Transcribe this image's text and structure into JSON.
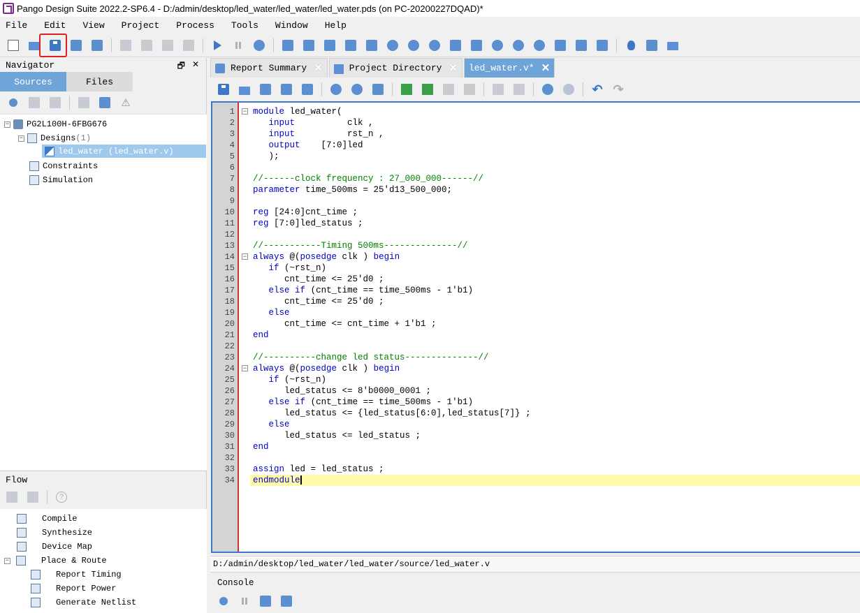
{
  "window": {
    "title": "Pango Design Suite 2022.2-SP6.4 - D:/admin/desktop/led_water/led_water/led_water.pds (on PC-20200227DQAD)*"
  },
  "menu": [
    "File",
    "Edit",
    "View",
    "Project",
    "Process",
    "Tools",
    "Window",
    "Help"
  ],
  "navigator": {
    "title": "Navigator",
    "tabs": [
      "Sources",
      "Files"
    ],
    "active_tab": "Sources",
    "tree": {
      "device": "PG2L100H-6FBG676",
      "designs_label": "Designs",
      "designs_count": "(1)",
      "design_file": "led_water (led_water.v)",
      "constraints": "Constraints",
      "simulation": "Simulation"
    }
  },
  "flow": {
    "title": "Flow",
    "items": [
      "Compile",
      "Synthesize",
      "Device Map",
      "Place & Route",
      "Report Timing",
      "Report Power",
      "Generate Netlist"
    ]
  },
  "editor": {
    "tabs": [
      {
        "label": "Report Summary",
        "active": false
      },
      {
        "label": "Project Directory",
        "active": false
      },
      {
        "label": "led_water.v*",
        "active": true
      }
    ],
    "current_line": 34,
    "code_lines": [
      "module led_water(",
      "   input          clk ,",
      "   input          rst_n ,",
      "   output    [7:0]led",
      "   );",
      "",
      "//------clock frequency : 27_000_000------//",
      "parameter time_500ms = 25'd13_500_000;",
      "",
      "reg [24:0]cnt_time ;",
      "reg [7:0]led_status ;",
      "",
      "//-----------Timing 500ms--------------//",
      "always @(posedge clk ) begin",
      "   if (~rst_n)",
      "      cnt_time <= 25'd0 ;",
      "   else if (cnt_time == time_500ms - 1'b1)",
      "      cnt_time <= 25'd0 ;",
      "   else",
      "      cnt_time <= cnt_time + 1'b1 ;",
      "end",
      "",
      "//----------change led status--------------//",
      "always @(posedge clk ) begin",
      "   if (~rst_n)",
      "      led_status <= 8'b0000_0001 ;",
      "   else if (cnt_time == time_500ms - 1'b1)",
      "      led_status <= {led_status[6:0],led_status[7]} ;",
      "   else",
      "      led_status <= led_status ;",
      "end",
      "",
      "assign led = led_status ;",
      "endmodule"
    ],
    "fold_lines": [
      1,
      14,
      24
    ],
    "file_path": "D:/admin/desktop/led_water/led_water/source/led_water.v"
  },
  "console": {
    "title": "Console"
  },
  "colors": {
    "keyword": "#0000c0",
    "comment": "#008000",
    "accent": "#6fa4d8",
    "highlight_box": "#e02020",
    "current_line_bg": "#fffaa8"
  }
}
